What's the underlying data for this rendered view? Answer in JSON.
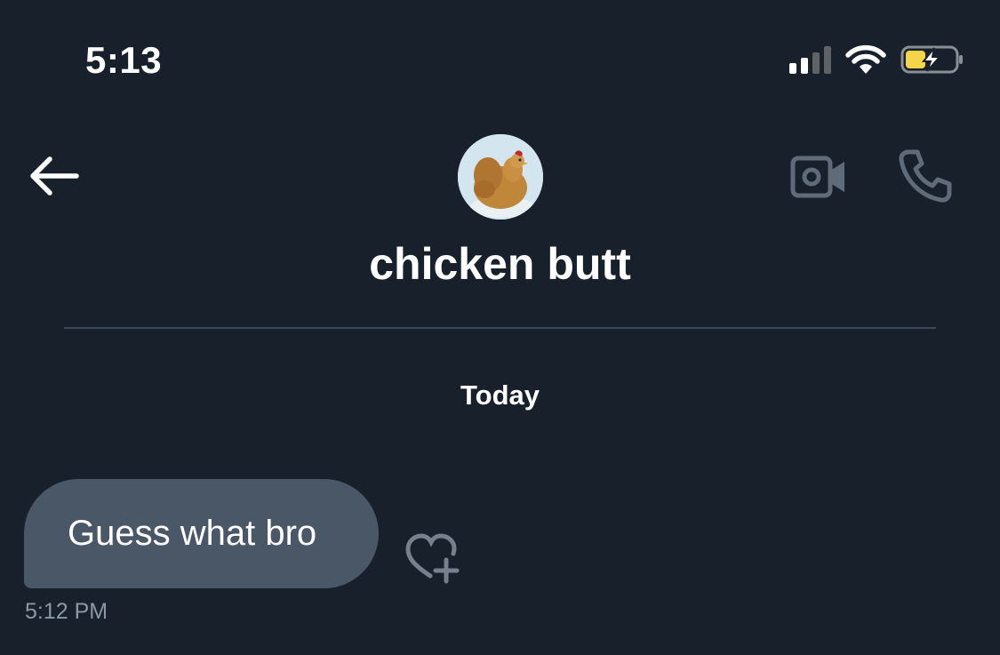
{
  "status_bar": {
    "time": "5:13",
    "icons": [
      "signal-icon",
      "wifi-icon",
      "battery-charging-icon"
    ]
  },
  "header": {
    "back_icon": "arrow-left-icon",
    "contact_name": "chicken butt",
    "avatar_icon": "chicken-avatar",
    "video_icon": "video-camera-icon",
    "phone_icon": "phone-icon"
  },
  "conversation": {
    "date_separator": "Today",
    "messages": [
      {
        "text": "Guess what bro",
        "time": "5:12 PM",
        "react_icon": "heart-plus-icon"
      }
    ]
  },
  "colors": {
    "background": "#17202b",
    "bubble": "#4a5766",
    "divider": "#3d4856",
    "muted_text": "#8b98a5",
    "battery_fill": "#f5d547"
  }
}
